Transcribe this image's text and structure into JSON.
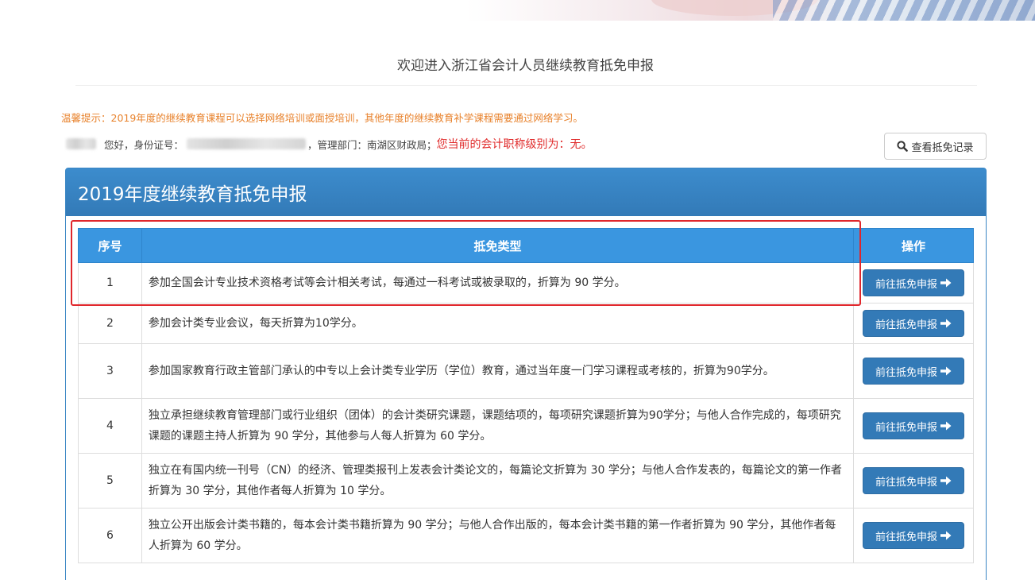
{
  "colors": {
    "primary": "#337ab7",
    "table_header": "#3a96e0",
    "tip_orange": "#e8822c",
    "alert_red": "#e02b2b",
    "highlight": "#e0262b"
  },
  "page": {
    "title": "欢迎进入浙江省会计人员继续教育抵免申报"
  },
  "tip": "温馨提示：2019年度的继续教育课程可以选择网络培训或面授培训，其他年度的继续教育补学课程需要通过网络学习。",
  "user": {
    "greeting": "您好，身份证号：",
    "dept": "，管理部门：南湖区财政局；",
    "level_text": "您当前的会计职称级别为：无。"
  },
  "history_button": {
    "icon": "search-icon",
    "label": "查看抵免记录"
  },
  "panel": {
    "title": "2019年度继续教育抵免申报"
  },
  "table": {
    "headers": [
      "序号",
      "抵免类型",
      "操作"
    ],
    "action_label": "前往抵免申报",
    "action_icon": "arrow-right-icon",
    "rows": [
      {
        "no": "1",
        "type": "参加全国会计专业技术资格考试等会计相关考试，每通过一科考试或被录取的，折算为 90 学分。"
      },
      {
        "no": "2",
        "type": "参加会计类专业会议，每天折算为10学分。"
      },
      {
        "no": "3",
        "type": "参加国家教育行政主管部门承认的中专以上会计类专业学历（学位）教育，通过当年度一门学习课程或考核的，折算为90学分。"
      },
      {
        "no": "4",
        "type": "独立承担继续教育管理部门或行业组织（团体）的会计类研究课题，课题结项的，每项研究课题折算为90学分；与他人合作完成的，每项研究课题的课题主持人折算为 90 学分，其他参与人每人折算为 60 学分。"
      },
      {
        "no": "5",
        "type": "独立在有国内统一刊号（CN）的经济、管理类报刊上发表会计类论文的，每篇论文折算为 30 学分；与他人合作发表的，每篇论文的第一作者折算为 30 学分，其他作者每人折算为 10 学分。"
      },
      {
        "no": "6",
        "type": "独立公开出版会计类书籍的，每本会计类书籍折算为 90 学分；与他人合作出版的，每本会计类书籍的第一作者折算为 90 学分，其他作者每人折算为 60 学分。"
      }
    ]
  }
}
